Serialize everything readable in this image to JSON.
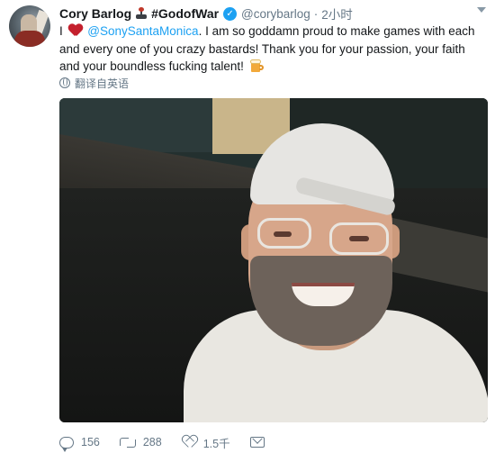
{
  "tweet": {
    "display_name": "Cory Barlog",
    "hashtag_name": "#GodofWar",
    "handle": "@corybarlog",
    "dot": "·",
    "timestamp": "2小时",
    "text": {
      "part1": "I",
      "mention": "@SonySantaMonica",
      "part2": ". I am so goddamn proud to make games with each and every one of you crazy bastards! Thank you for your passion, your faith and your boundless fucking talent!"
    },
    "translate_label": "翻译自英语",
    "icons": [
      "joystick-icon",
      "verified-icon",
      "heart-icon",
      "beer-icon",
      "globe-icon",
      "caret-icon"
    ]
  },
  "actions": {
    "reply_count": "156",
    "retweet_count": "288",
    "like_count": "1.5千",
    "icons": [
      "reply-icon",
      "retweet-icon",
      "like-icon",
      "dm-icon"
    ]
  },
  "colors": {
    "link": "#1da1f2",
    "muted": "#657786",
    "text": "#14171a",
    "heart": "#c4202d"
  }
}
